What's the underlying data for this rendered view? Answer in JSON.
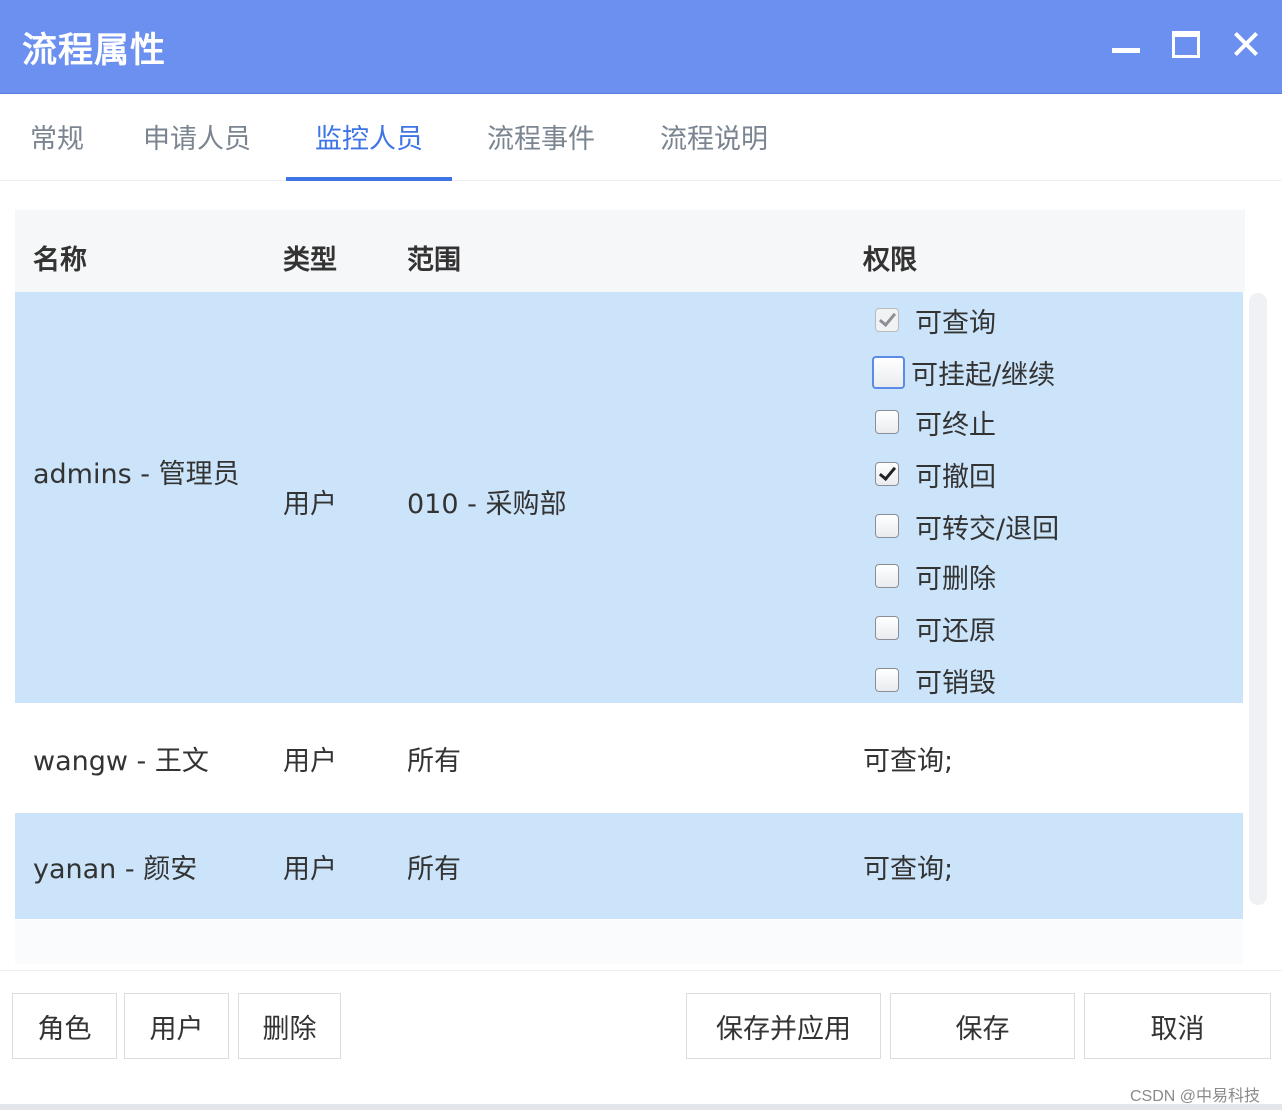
{
  "window": {
    "title": "流程属性"
  },
  "tabs": [
    {
      "label": "常规",
      "active": false
    },
    {
      "label": "申请人员",
      "active": false
    },
    {
      "label": "监控人员",
      "active": true
    },
    {
      "label": "流程事件",
      "active": false
    },
    {
      "label": "流程说明",
      "active": false
    }
  ],
  "table": {
    "headers": {
      "name": "名称",
      "type": "类型",
      "scope": "范围",
      "permission": "权限"
    },
    "rows": [
      {
        "name": "admins - 管理员",
        "type": "用户",
        "scope": "010 - 采购部",
        "selected": true,
        "permissions": [
          {
            "label": "可查询",
            "checked": true,
            "disabled": true
          },
          {
            "label": "可挂起/继续",
            "checked": false,
            "focused": true
          },
          {
            "label": "可终止",
            "checked": false
          },
          {
            "label": "可撤回",
            "checked": true
          },
          {
            "label": "可转交/退回",
            "checked": false
          },
          {
            "label": "可删除",
            "checked": false
          },
          {
            "label": "可还原",
            "checked": false
          },
          {
            "label": "可销毁",
            "checked": false
          }
        ]
      },
      {
        "name": "wangw - 王文",
        "type": "用户",
        "scope": "所有",
        "permission_text": "可查询;",
        "selected": false
      },
      {
        "name": "yanan - 颜安",
        "type": "用户",
        "scope": "所有",
        "permission_text": "可查询;",
        "selected": true
      }
    ]
  },
  "footer": {
    "role_button": "角色",
    "user_button": "用户",
    "delete_button": "删除",
    "save_apply_button": "保存并应用",
    "save_button": "保存",
    "cancel_button": "取消"
  },
  "watermark": "CSDN @中易科技",
  "colors": {
    "titlebar": "#6b90f0",
    "accent": "#3f74e6",
    "selected_row": "#cce4fa"
  }
}
